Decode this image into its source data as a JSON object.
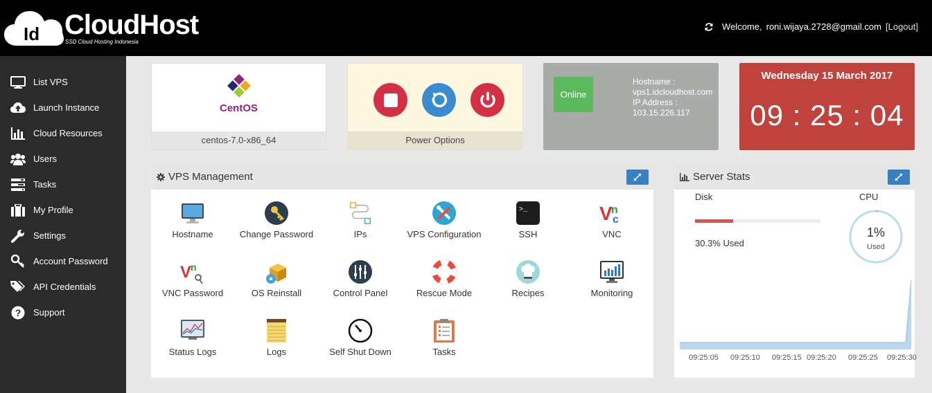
{
  "header": {
    "brand": "CloudHost",
    "brand_badge": "Id",
    "tagline": "SSD Cloud Hosting Indonesia",
    "welcome": "Welcome,",
    "email": "roni.wijaya.2728@gmail.com",
    "logout": "[Logout]"
  },
  "sidebar": {
    "items": [
      {
        "label": "List VPS",
        "icon": "monitor-icon"
      },
      {
        "label": "Launch Instance",
        "icon": "cloud-upload-icon"
      },
      {
        "label": "Cloud Resources",
        "icon": "bar-chart-icon"
      },
      {
        "label": "Users",
        "icon": "users-icon"
      },
      {
        "label": "Tasks",
        "icon": "tasks-icon"
      },
      {
        "label": "My Profile",
        "icon": "briefcase-icon"
      },
      {
        "label": "Settings",
        "icon": "wrench-icon"
      },
      {
        "label": "Account Password",
        "icon": "key-icon"
      },
      {
        "label": "API Credentials",
        "icon": "tags-icon"
      },
      {
        "label": "Support",
        "icon": "question-icon"
      }
    ]
  },
  "os": {
    "logo_text": "CentOS",
    "name": "centos-7.0-x86_64"
  },
  "power": {
    "label": "Power Options"
  },
  "status": {
    "state": "Online",
    "hostname_label": "Hostname :",
    "hostname": "vps1.idcloudhost.com",
    "ip_label": "IP Address :",
    "ip": "103.15.226.117"
  },
  "clock": {
    "date": "Wednesday 15 March 2017",
    "time": "09 : 25 : 04"
  },
  "vps": {
    "title": "VPS Management",
    "tiles": [
      "Hostname",
      "Change Password",
      "IPs",
      "VPS Configuration",
      "SSH",
      "VNC",
      "VNC Password",
      "OS Reinstall",
      "Control Panel",
      "Rescue Mode",
      "Recipes",
      "Monitoring",
      "Status Logs",
      "Logs",
      "Self Shut Down",
      "Tasks"
    ]
  },
  "stats": {
    "title": "Server Stats",
    "disk_label": "Disk",
    "disk_used_text": "30.3% Used",
    "disk_fraction": 0.303,
    "cpu_label": "CPU",
    "cpu_value": "1%",
    "cpu_sub": "Used",
    "cpu_fraction": 0.01,
    "chart_times": [
      "09:25:05",
      "09:25:10",
      "09:25:15",
      "09:25:20",
      "09:25:25",
      "09:25:30"
    ]
  },
  "colors": {
    "accent_blue": "#3a7fc4",
    "online_green": "#5bb85d",
    "clock_red": "#c0423d",
    "disk_red": "#d9534f"
  }
}
